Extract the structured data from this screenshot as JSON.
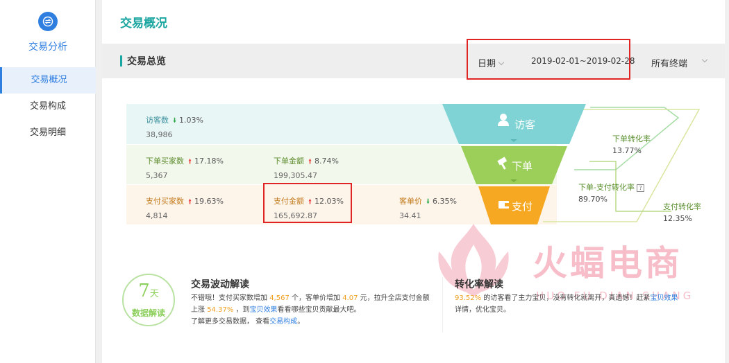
{
  "sidebar": {
    "title": "交易分析",
    "items": [
      {
        "label": "交易概况",
        "active": true
      },
      {
        "label": "交易构成"
      },
      {
        "label": "交易明细"
      }
    ]
  },
  "page": {
    "title": "交易概况"
  },
  "toolbar": {
    "title": "交易总览",
    "date_label": "日期",
    "date_range": "2019-02-01~2019-02-28",
    "terminal": "所有终端"
  },
  "stats": {
    "visitors": {
      "label": "访客数",
      "direction": "down",
      "pct": "1.03%",
      "value": "38,986"
    },
    "order_buyers": {
      "label": "下单买家数",
      "direction": "up",
      "pct": "17.18%",
      "value": "5,367"
    },
    "order_amount": {
      "label": "下单金额",
      "direction": "up",
      "pct": "8.74%",
      "value": "199,305.47"
    },
    "pay_buyers": {
      "label": "支付买家数",
      "direction": "up",
      "pct": "19.63%",
      "value": "4,814"
    },
    "pay_amount": {
      "label": "支付金额",
      "direction": "up",
      "pct": "12.03%",
      "value": "165,692.87"
    },
    "avg_price": {
      "label": "客单价",
      "direction": "down",
      "pct": "6.35%",
      "value": "34.41"
    }
  },
  "funnel": {
    "visit": "访客",
    "order": "下单",
    "pay": "支付",
    "colors": {
      "visit": "#7fd3d4",
      "order": "#9ccf5a",
      "pay": "#f7a823"
    }
  },
  "rates": {
    "order_rate": {
      "label": "下单转化率",
      "value": "13.77%"
    },
    "order_pay_rate": {
      "label": "下单-支付转化率",
      "value": "89.70%",
      "help": "?"
    },
    "pay_rate": {
      "label": "支付转化率",
      "value": "12.35%"
    }
  },
  "badge": {
    "num": "7",
    "unit": "天",
    "text": "数据解读"
  },
  "wave": {
    "title": "交易波动解读",
    "t1": "不错哦！支付买家数增加 ",
    "n1": "4,567",
    "t2": " 个，客单价增加 ",
    "n2": "4.07",
    "t3": " 元，拉升全店支付金额上涨 ",
    "n3": "54.37%",
    "t4": " ，到",
    "link1": "宝贝效果",
    "t5": "看看哪些宝贝贡献最大吧。",
    "t6": "了解更多交易数据， 查看",
    "link2": "交易构成",
    "t7": "。"
  },
  "conversion": {
    "title": "转化率解读",
    "n1": "93.52%",
    "t1": " 的访客看了主力宝贝，没有转化就离开，真遗憾！赶紧",
    "link": "宝贝效果",
    "t2": "详情，优化宝贝。"
  },
  "watermark": {
    "text": "火蝠电商",
    "sub": "HUO FU DIAN SHANG"
  }
}
